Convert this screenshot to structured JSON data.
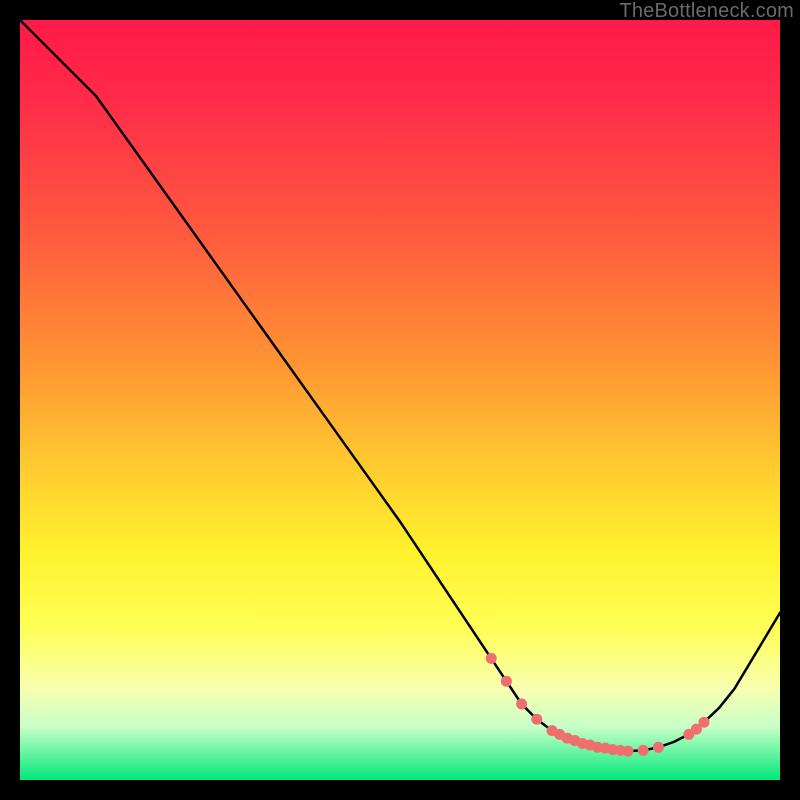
{
  "watermark": "TheBottleneck.com",
  "chart_data": {
    "type": "line",
    "title": "",
    "xlabel": "",
    "ylabel": "",
    "xlim": [
      0,
      100
    ],
    "ylim": [
      0,
      100
    ],
    "grid": false,
    "legend": false,
    "description": "Bottleneck curve over a red-to-green vertical gradient background. The black line descends from top-left to a minimum around x≈80 and rises again toward the right edge. Salmon points cluster near the minimum.",
    "series": [
      {
        "name": "curve",
        "type": "line",
        "color": "#000000",
        "x": [
          0,
          6,
          10,
          20,
          30,
          40,
          50,
          58,
          62,
          66,
          68,
          70,
          72,
          74,
          76,
          78,
          80,
          82,
          84,
          86,
          88,
          90,
          92,
          94,
          100
        ],
        "y": [
          100,
          94,
          90,
          76,
          62,
          48,
          34,
          22,
          16,
          10,
          8,
          6.5,
          5.5,
          4.8,
          4.3,
          4.0,
          3.8,
          3.9,
          4.3,
          5.0,
          6.0,
          7.6,
          9.5,
          12,
          22
        ]
      },
      {
        "name": "points",
        "type": "scatter",
        "color": "#ef6f6f",
        "x": [
          62,
          64,
          66,
          68,
          70,
          71,
          72,
          73,
          74,
          75,
          76,
          77,
          78,
          79,
          80,
          82,
          84,
          88,
          89,
          90
        ],
        "y": [
          16,
          13,
          10,
          8,
          6.5,
          6.0,
          5.5,
          5.2,
          4.8,
          4.6,
          4.3,
          4.2,
          4.0,
          3.9,
          3.8,
          3.9,
          4.3,
          6.0,
          6.7,
          7.6
        ]
      }
    ]
  }
}
